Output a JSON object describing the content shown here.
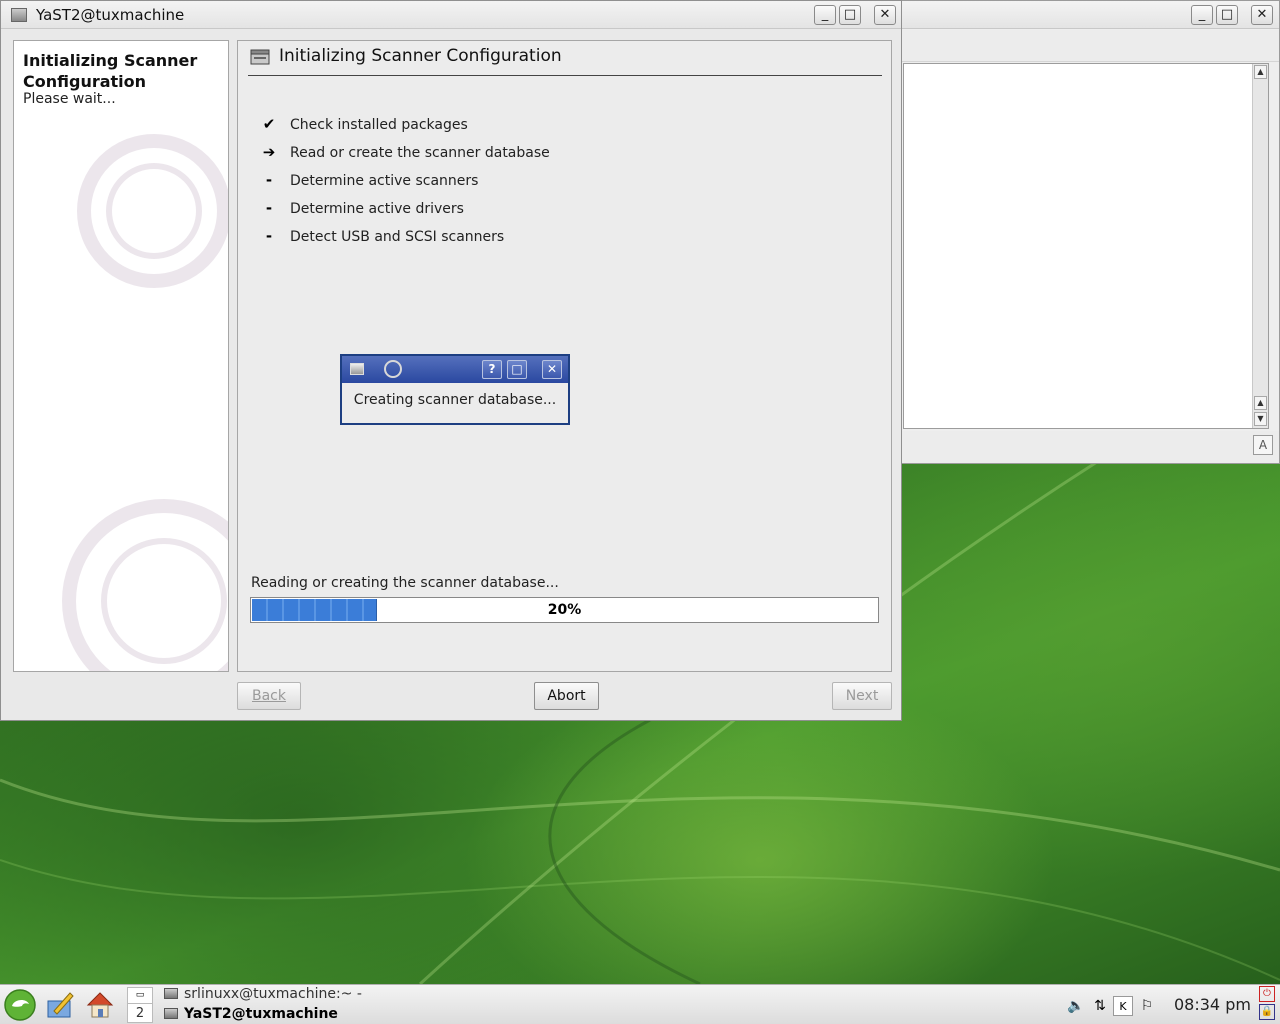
{
  "main_window": {
    "title": "YaST2@tuxmachine",
    "buttons": {
      "minimize": "_",
      "maximize": "□",
      "close": "✕"
    }
  },
  "help": {
    "title": "Initializing Scanner Configuration",
    "body": "Please wait..."
  },
  "content": {
    "heading": "Initializing Scanner Configuration",
    "steps": [
      {
        "mark": "✔",
        "label": "Check installed packages",
        "state": "done"
      },
      {
        "mark": "➔",
        "label": "Read or create the scanner database",
        "state": "current"
      },
      {
        "mark": "-",
        "label": "Determine active scanners",
        "state": "pending"
      },
      {
        "mark": "-",
        "label": "Determine active drivers",
        "state": "pending"
      },
      {
        "mark": "-",
        "label": "Detect USB and SCSI scanners",
        "state": "pending"
      }
    ],
    "progress": {
      "label": "Reading or creating the scanner database...",
      "value": 0.2,
      "text": "20%"
    }
  },
  "footer": {
    "back_label": "Back",
    "abort_label": "Abort",
    "next_label": "Next"
  },
  "popup": {
    "message": "Creating scanner database...",
    "buttons": {
      "help": "?",
      "maximize": "□",
      "close": "✕"
    }
  },
  "taskbar": {
    "pager": {
      "desktop_number": "2"
    },
    "tasks": [
      {
        "label": "srlinuxx@tuxmachine:~ - S",
        "active": false
      },
      {
        "label": "YaST2@tuxmachine",
        "active": true
      }
    ],
    "clock": "08:34 pm"
  },
  "colors": {
    "progress_fill": "#3b7dd8",
    "popup_titlebar": "#2a48a0",
    "desktop": "#3d8a2c"
  },
  "icons": {
    "start_menu": "opensuse-gecko-icon",
    "launcher_1": "kde-writer-icon",
    "launcher_2": "home-folder-icon",
    "tray": [
      "volume-icon",
      "network-icon",
      "klipper-icon",
      "update-icon"
    ]
  }
}
